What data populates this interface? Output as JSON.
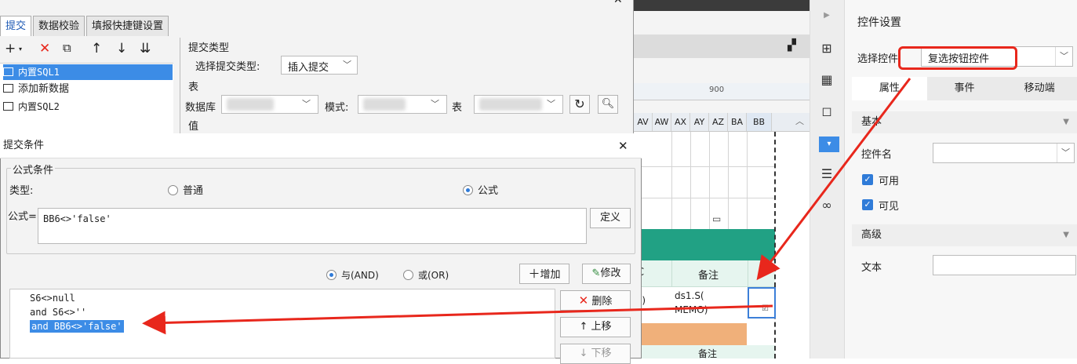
{
  "dialog_settings": {
    "tabs": [
      "提交",
      "数据校验",
      "填报快捷键设置"
    ],
    "active_tab": "提交",
    "tree_items": [
      "内置SQL1",
      "添加新数据",
      "内置SQL2"
    ],
    "submit_type_group": "提交类型",
    "select_type_label": "选择提交类型:",
    "select_type_value": "插入提交",
    "table_section": "表",
    "database_label": "数据库",
    "schema_label": "模式:",
    "table_label": "表",
    "value_section": "值"
  },
  "dialog_condition": {
    "title": "提交条件",
    "group_title": "公式条件",
    "type_label": "类型:",
    "radio_normal": "普通",
    "radio_formula": "公式",
    "formula_label": "公式=",
    "formula_value": "BB6<>'false'",
    "define_button": "定义",
    "and_label": "与(AND)",
    "or_label": "或(OR)",
    "add_button": "增加",
    "modify_button": "修改",
    "conditions": [
      "S6<>null",
      "and S6<>''",
      "and BB6<>'false'"
    ],
    "delete_button": "删除",
    "move_up_button": "上移",
    "move_down_button": "下移"
  },
  "sheet": {
    "ruler_mark": "900",
    "columns": [
      "AV",
      "AW",
      "AX",
      "AY",
      "AZ",
      "BA",
      "BB"
    ],
    "header_cell": "备注",
    "header_cell_left": "C",
    "data_cell": "ds1.S(\nMEMO)",
    "data_cell_left": "C)",
    "bottom_cell": "备注"
  },
  "properties": {
    "title": "控件设置",
    "select_control_label": "选择控件",
    "select_control_value": "复选按钮控件",
    "tabs": [
      "属性",
      "事件",
      "移动端"
    ],
    "active_tab": "属性",
    "section_basic": "基本",
    "control_name_label": "控件名",
    "enabled_label": "可用",
    "visible_label": "可见",
    "section_advanced": "高级",
    "text_label": "文本"
  },
  "colors": {
    "highlight_red": "#e8271c",
    "selection_blue": "#3c8ce6",
    "teal_header": "#21a184",
    "orange_row": "#f0b07a"
  }
}
